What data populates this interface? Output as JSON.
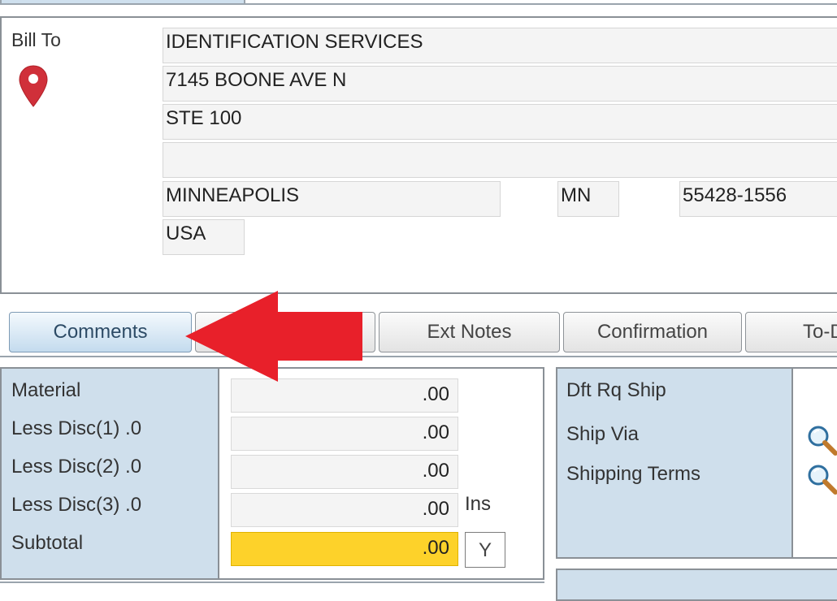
{
  "bill_to": {
    "label": "Bill To",
    "name": "IDENTIFICATION SERVICES",
    "address1": "7145 BOONE AVE N",
    "address2": "STE 100",
    "address3": "",
    "city": "MINNEAPOLIS",
    "state": "MN",
    "zip": "55428-1556",
    "country": "USA"
  },
  "tabs": [
    {
      "label": "Comments"
    },
    {
      "label": ""
    },
    {
      "label": "Ext Notes"
    },
    {
      "label": "Confirmation"
    },
    {
      "label": "To-Do"
    }
  ],
  "totals": {
    "rows": [
      {
        "label": "Material",
        "value": ".00"
      },
      {
        "label": "Less Disc(1) .0",
        "value": ".00"
      },
      {
        "label": "Less Disc(2) .0",
        "value": ".00"
      },
      {
        "label": "Less Disc(3) .0",
        "value": ".00"
      },
      {
        "label": "Subtotal",
        "value": ".00"
      }
    ],
    "ins_label": "Ins",
    "ins_flag": "Y"
  },
  "shipping": {
    "default_request_ship_label": "Dft Rq Ship",
    "ship_via_label": "Ship Via",
    "shipping_terms_label": "Shipping Terms"
  },
  "colors": {
    "pin": "#d0303a",
    "arrow": "#e8202a",
    "highlight": "#fdd22a",
    "label_panel": "#cfdfec"
  },
  "icons": {
    "location": "map-pin-icon",
    "lookup": "magnifier-icon",
    "annotation": "red-arrow-left"
  }
}
